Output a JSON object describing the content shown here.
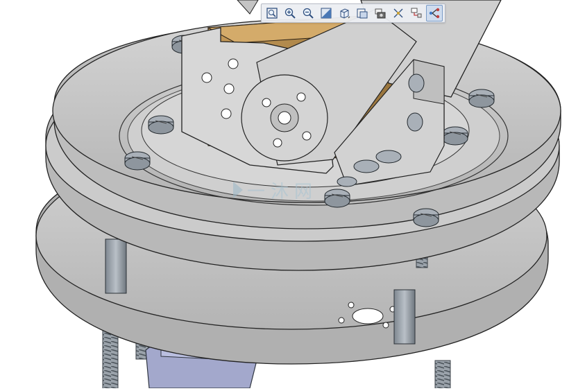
{
  "app": {
    "view": "3d-model-viewport"
  },
  "toolbar": {
    "buttons": [
      {
        "name": "zoom-fit",
        "icon": "zoom-fit-icon"
      },
      {
        "name": "zoom-in",
        "icon": "zoom-in-icon"
      },
      {
        "name": "zoom-out",
        "icon": "zoom-out-icon"
      },
      {
        "name": "display-style",
        "icon": "shaded-icon"
      },
      {
        "name": "view-orientation",
        "icon": "cube-view-icon"
      },
      {
        "name": "section-view",
        "icon": "section-view-icon"
      },
      {
        "name": "snapshot",
        "icon": "camera-icon"
      },
      {
        "name": "explode",
        "icon": "explode-icon"
      },
      {
        "name": "annotations",
        "icon": "annotation-icon"
      },
      {
        "name": "model-tree",
        "icon": "tree-icon"
      }
    ]
  },
  "watermark": {
    "text": "一沐网"
  },
  "colors": {
    "metal": "#c6c6c6",
    "metal_dark": "#8c8c8c",
    "servo": "#b58a4d",
    "motor": "#9aa0c4",
    "selected": "#3c78c8"
  }
}
